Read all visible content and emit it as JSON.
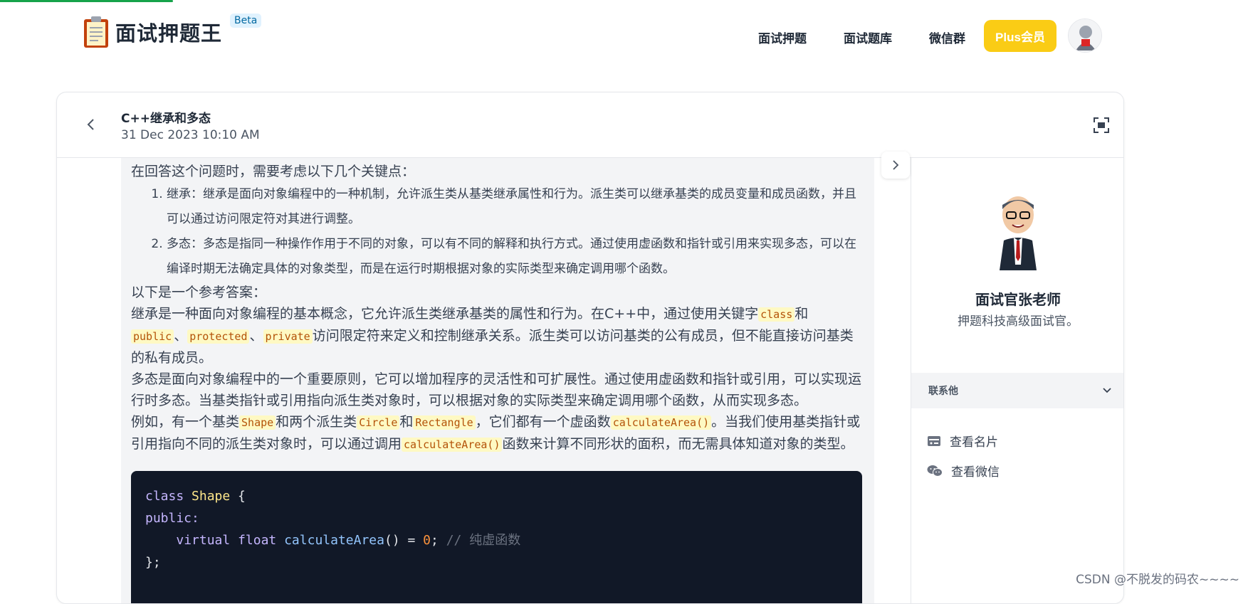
{
  "app": {
    "logo_text": "面试押题王",
    "beta_badge": "Beta"
  },
  "nav": {
    "items": [
      "面试押题",
      "面试题库",
      "微信群"
    ],
    "plus_label": "Plus会员"
  },
  "question": {
    "title": "C++继承和多态",
    "date": "31 Dec 2023 10:10 AM"
  },
  "answer": {
    "intro": "在回答这个问题时，需要考虑以下几个关键点：",
    "points": [
      "继承：继承是面向对象编程中的一种机制，允许派生类从基类继承属性和行为。派生类可以继承基类的成员变量和成员函数，并且可以通过访问限定符对其进行调整。",
      "多态：多态是指同一种操作作用于不同的对象，可以有不同的解释和执行方式。通过使用虚函数和指针或引用来实现多态，可以在编译时期无法确定具体的对象类型，而是在运行时期根据对象的实际类型来确定调用哪个函数。"
    ],
    "ref_heading": "以下是一个参考答案：",
    "p1_a": "继承是一种面向对象编程的基本概念，它允许派生类继承基类的属性和行为。在C++中，通过使用关键字",
    "kw_class": "class",
    "p1_b": "和",
    "kw_public": "public",
    "sep1": "、",
    "kw_protected": "protected",
    "sep2": "、",
    "kw_private": "private",
    "p1_c": "访问限定符来定义和控制继承关系。派生类可以访问基类的公有成员，但不能直接访问基类的私有成员。",
    "p2": "多态是面向对象编程中的一个重要原则，它可以增加程序的灵活性和可扩展性。通过使用虚函数和指针或引用，可以实现运行时多态。当基类指针或引用指向派生类对象时，可以根据对象的实际类型来确定调用哪个函数，从而实现多态。",
    "p3_a": "例如，有一个基类",
    "code_shape": "Shape",
    "p3_b": "和两个派生类",
    "code_circle": "Circle",
    "p3_c": "和",
    "code_rectangle": "Rectangle",
    "p3_d": "，它们都有一个虚函数",
    "code_calc1": "calculateArea()",
    "p3_e": "。当我们使用基类指针或引用指向不同的派生类对象时，可以通过调用",
    "code_calc2": "calculateArea()",
    "p3_f": "函数来计算不同形状的面积，而无需具体知道对象的类型。",
    "code": {
      "l1_kw": "class",
      "l1_type": "Shape",
      "l1_rest": " {",
      "l2": "public:",
      "l3_kw1": "virtual",
      "l3_kw2": "float",
      "l3_fn": "calculateArea",
      "l3_mid": "() = ",
      "l3_num": "0",
      "l3_semi": "; ",
      "l3_comment": "// 纯虚函数",
      "l4": "};"
    }
  },
  "sidebar": {
    "teacher_name": "面试官张老师",
    "teacher_desc": "押题科技高级面试官。",
    "contact_label": "联系他",
    "links": [
      "查看名片",
      "查看微信"
    ]
  },
  "watermark": "CSDN @不脱发的码农~~~~",
  "colors": {
    "accent": "#facc15",
    "progress": "#16a34a",
    "code_bg": "#111827"
  }
}
